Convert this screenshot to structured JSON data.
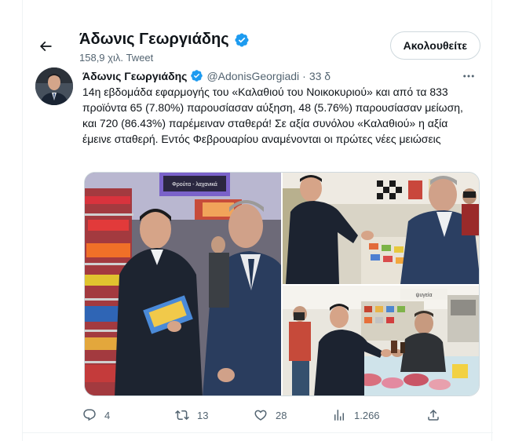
{
  "header": {
    "name": "Άδωνις Γεωργιάδης",
    "tweet_count": "158,9 χιλ. Tweet",
    "follow_label": "Ακολουθείτε"
  },
  "tweet": {
    "name": "Άδωνις Γεωργιάδης",
    "handle": "@AdonisGeorgiadi",
    "separator": "·",
    "time": "33 δ",
    "text": "14η εβδομάδα εφαρμογής του «Καλαθιού του Νοικοκυριού» και από τα 833 προϊόντα 65 (7.80%) παρουσίασαν αύξηση, 48 (5.76%) παρουσίασαν μείωση, και 720 (86.43%) παρέμειναν σταθερά! Σε αξία συνόλου «Καλαθιού» η αξία έμεινε σταθερή. Εντός Φεβρουαρίου αναμένονται οι πρώτες νέες μειώσεις",
    "store_sign": "Φρούτα - λαχανικά",
    "sign2": "ψυγεία"
  },
  "actions": {
    "replies": "4",
    "retweets": "13",
    "likes": "28",
    "views": "1.266"
  },
  "icons": {
    "back": "arrow-left-icon",
    "verified": "verified-badge-icon",
    "more": "more-dots-icon",
    "reply": "reply-icon",
    "retweet": "retweet-icon",
    "like": "heart-icon",
    "views": "views-chart-icon",
    "share": "share-icon"
  },
  "colors": {
    "verified": "#1d9bf0",
    "text": "#0f1419",
    "secondary": "#536471"
  }
}
